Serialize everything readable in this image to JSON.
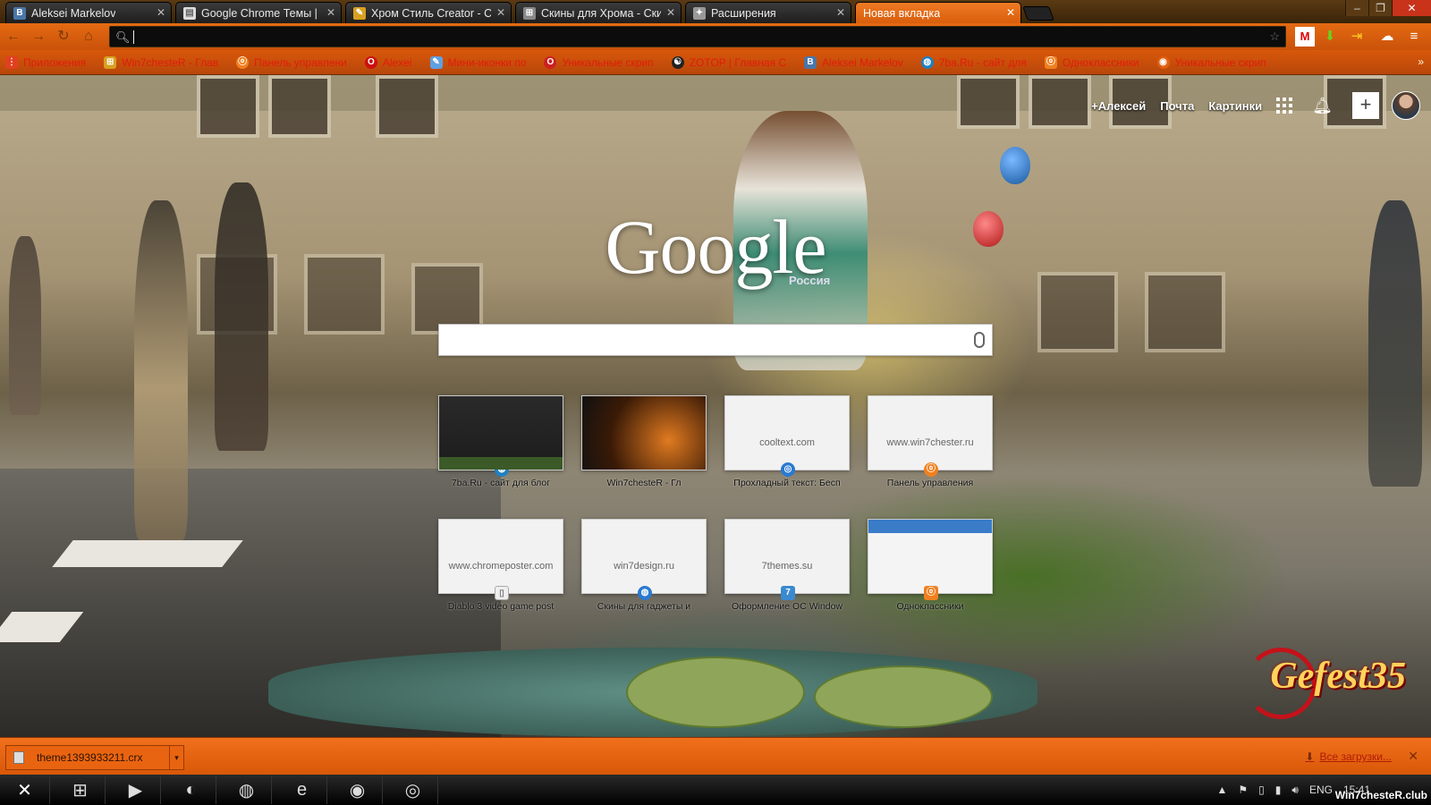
{
  "browser": {
    "tabs": [
      {
        "label": "Aleksei Markelov",
        "favicon": "vk-icon",
        "color": "#4a76a8",
        "active": false
      },
      {
        "label": "Google Chrome Темы | R",
        "favicon": "page-icon",
        "color": "#cccccc",
        "active": false
      },
      {
        "label": "Хром Стиль Creator - Co",
        "favicon": "palette-icon",
        "color": "#d8a020",
        "active": false
      },
      {
        "label": "Скины для Хрома - Скин",
        "favicon": "windows-icon",
        "color": "#888888",
        "active": false
      },
      {
        "label": "Расширения",
        "favicon": "puzzle-icon",
        "color": "#999999",
        "active": false
      },
      {
        "label": "Новая вкладка",
        "favicon": "",
        "color": "",
        "active": true
      }
    ],
    "omnibox": {
      "value": ""
    },
    "bookmarks": [
      {
        "label": "Приложения",
        "icon": "apps-icon",
        "color": "#e04020"
      },
      {
        "label": "Win7chesteR - Глав",
        "icon": "windows-icon",
        "color": "#d8a020"
      },
      {
        "label": "Панель управлени",
        "icon": "odnoklassniki-icon",
        "color": "#f08020"
      },
      {
        "label": "Alexei",
        "icon": "opera-icon",
        "color": "#cc1010"
      },
      {
        "label": "Мини-иконки по",
        "icon": "feather-icon",
        "color": "#60a0e0"
      },
      {
        "label": "Уникальные скрип",
        "icon": "opera-icon",
        "color": "#cc2020"
      },
      {
        "label": "ZOTOP | Главная С",
        "icon": "yin-yang-icon",
        "color": "#222222"
      },
      {
        "label": "Aleksei Markelov",
        "icon": "vk-icon",
        "color": "#4a76a8"
      },
      {
        "label": "7ba.Ru - сайт для",
        "icon": "globe-icon",
        "color": "#2080c0"
      },
      {
        "label": "Одноклассники",
        "icon": "odnoklassniki-icon",
        "color": "#f08020"
      },
      {
        "label": "Уникальные скрип",
        "icon": "firefox-icon",
        "color": "#e06010"
      }
    ]
  },
  "google": {
    "links": [
      "+Алексей",
      "Почта",
      "Картинки"
    ],
    "logo": "Google",
    "region": "Россия",
    "search_value": ""
  },
  "tiles": [
    {
      "url": "",
      "caption": "7ba.Ru - сайт для блог",
      "thumb": "dark",
      "fav_color": "#2080c0"
    },
    {
      "url": "",
      "caption": "Win7chesteR - Гл",
      "thumb": "orange",
      "fav_color": "#d8a020"
    },
    {
      "url": "cooltext.com",
      "caption": "Прохладный текст: Бесп",
      "thumb": "plain",
      "fav_color": "#2a7ad0"
    },
    {
      "url": "www.win7chester.ru",
      "caption": "Панель управления",
      "thumb": "plain",
      "fav_color": "#f08020"
    },
    {
      "url": "www.chromeposter.com",
      "caption": "Diablo 3 video game post",
      "thumb": "plain",
      "fav_color": "#eeeeee"
    },
    {
      "url": "win7design.ru",
      "caption": "Скины для гаджеты и",
      "thumb": "plain",
      "fav_color": "#2a7ad0"
    },
    {
      "url": "7themes.su",
      "caption": "Оформление ОС Window",
      "thumb": "plain",
      "fav_color": "#3a8ad0"
    },
    {
      "url": "",
      "caption": "Одноклассники",
      "thumb": "ok",
      "fav_color": "#f08020"
    }
  ],
  "watermark": "Gefest35",
  "download": {
    "file": "theme1393933211.crx",
    "all_label": "Все загрузки..."
  },
  "tray": {
    "lang": "ENG",
    "time": "15:41",
    "site": "Win7chesteR.club"
  },
  "colors": {
    "accent": "#e56a12",
    "active_tab": "#ef7a24",
    "bookmark_text": "#e21c0c"
  }
}
